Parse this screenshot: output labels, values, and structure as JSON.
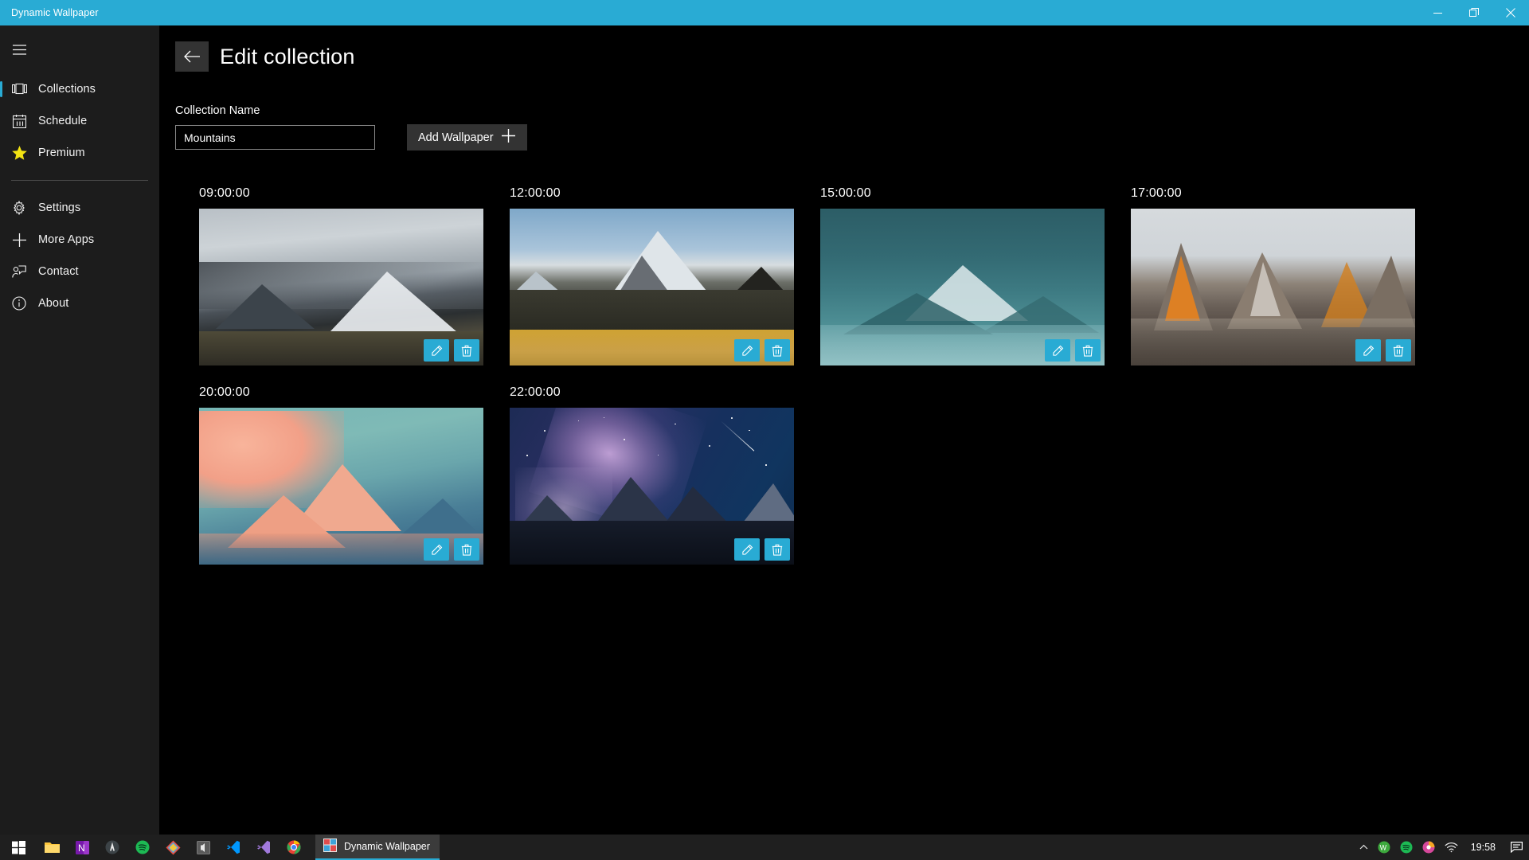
{
  "window": {
    "title": "Dynamic Wallpaper",
    "accent": "#29ABD4",
    "minimize_label": "Minimize",
    "maximize_label": "Restore",
    "close_label": "Close"
  },
  "sidebar": {
    "menu_label": "Menu",
    "items": [
      {
        "label": "Collections",
        "icon": "collections-icon",
        "selected": true
      },
      {
        "label": "Schedule",
        "icon": "calendar-icon",
        "selected": false
      },
      {
        "label": "Premium",
        "icon": "star-icon",
        "selected": false
      },
      {
        "label": "Settings",
        "icon": "gear-icon",
        "selected": false
      },
      {
        "label": "More Apps",
        "icon": "plus-icon",
        "selected": false
      },
      {
        "label": "Contact",
        "icon": "contact-icon",
        "selected": false
      },
      {
        "label": "About",
        "icon": "info-icon",
        "selected": false
      }
    ]
  },
  "page": {
    "title": "Edit collection",
    "back_label": "Back",
    "name_field_label": "Collection Name",
    "name_value": "Mountains",
    "name_placeholder": "Collection Name",
    "add_wallpaper_label": "Add Wallpaper",
    "edit_label": "Edit",
    "delete_label": "Delete"
  },
  "wallpapers": [
    {
      "time": "09:00:00",
      "scene": "snowy-range-overcast"
    },
    {
      "time": "12:00:00",
      "scene": "sierra-peak-golden-field"
    },
    {
      "time": "15:00:00",
      "scene": "teal-misty-peak"
    },
    {
      "time": "17:00:00",
      "scene": "torres-sunset-spires"
    },
    {
      "time": "20:00:00",
      "scene": "pink-alpenglow-peak"
    },
    {
      "time": "22:00:00",
      "scene": "milky-way-night-range"
    }
  ],
  "taskbar": {
    "start_label": "Start",
    "pinned": [
      {
        "name": "file-explorer-icon",
        "color": "#FFC83D"
      },
      {
        "name": "onenote-icon",
        "color": "#7719AA"
      },
      {
        "name": "yandex-browser-icon",
        "color": "#3C4347"
      },
      {
        "name": "spotify-icon",
        "color": "#1DB954"
      },
      {
        "name": "nexusmods-icon",
        "color": "#DA4F4F"
      },
      {
        "name": "media-player-icon",
        "color": "#4A4A4A"
      },
      {
        "name": "vscode-icon",
        "color": "#0098FF"
      },
      {
        "name": "visual-studio-icon",
        "color": "#A179DC"
      },
      {
        "name": "chrome-icon",
        "color": "#EA4335"
      }
    ],
    "active_app": {
      "label": "Dynamic Wallpaper",
      "icon": "dynamic-wallpaper-icon"
    },
    "tray": [
      {
        "name": "show-hidden-icons-chevron",
        "color": "#e6e6e6"
      },
      {
        "name": "wox-icon",
        "color": "#3DA93D"
      },
      {
        "name": "spotify-tray-icon",
        "color": "#1DB954"
      },
      {
        "name": "poweriso-tray-icon",
        "color": "#D6489B"
      },
      {
        "name": "wifi-icon",
        "color": "#e6e6e6"
      }
    ],
    "clock": "19:58",
    "notifications_label": "Notifications"
  }
}
